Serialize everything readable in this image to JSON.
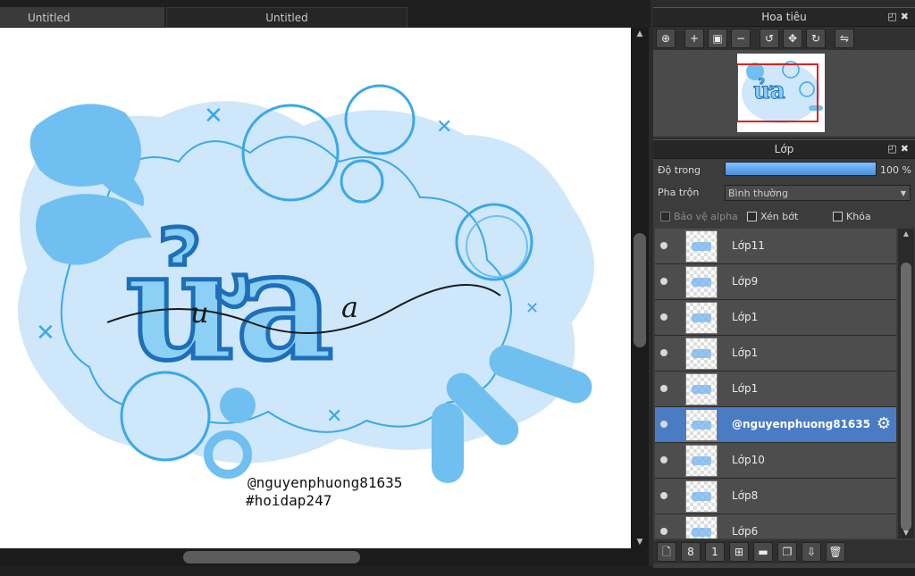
{
  "tabs": [
    {
      "label": "Untitled"
    },
    {
      "label": "Untitled"
    }
  ],
  "navigator": {
    "title": "Hoa tiêu",
    "tools": [
      {
        "icon": "zoom-fit-icon",
        "glyph": "⊕"
      },
      {
        "icon": "zoom-in-icon",
        "glyph": "+"
      },
      {
        "icon": "fit-screen-icon",
        "glyph": "▣"
      },
      {
        "icon": "zoom-out-icon",
        "glyph": "−"
      },
      {
        "icon": "rotate-left-icon",
        "glyph": "↺"
      },
      {
        "icon": "reset-icon",
        "glyph": "✥"
      },
      {
        "icon": "rotate-right-icon",
        "glyph": "↻"
      },
      {
        "icon": "flip-icon",
        "glyph": "⇋"
      }
    ]
  },
  "layers_panel": {
    "title": "Lớp",
    "opacity_label": "Độ trong",
    "opacity_value": "100 %",
    "opacity_fraction": 1.0,
    "blend_label": "Pha trộn",
    "blend_value": "Bình thường",
    "protect_alpha": "Bảo vệ alpha",
    "clip": "Xén bớt",
    "lock": "Khóa",
    "layers": [
      {
        "name": "Lớp11",
        "selected": false
      },
      {
        "name": "Lớp9",
        "selected": false
      },
      {
        "name": "Lớp1",
        "selected": false
      },
      {
        "name": "Lớp1",
        "selected": false
      },
      {
        "name": "Lớp1",
        "selected": false
      },
      {
        "name": "@nguyenphuong81635",
        "selected": true
      },
      {
        "name": "Lớp10",
        "selected": false
      },
      {
        "name": "Lớp8",
        "selected": false
      },
      {
        "name": "Lớp6",
        "selected": false
      }
    ],
    "bottom_tools": [
      {
        "icon": "new-layer-icon",
        "glyph": "🗋"
      },
      {
        "icon": "new-8bit-layer-icon",
        "glyph": "8"
      },
      {
        "icon": "new-1bit-layer-icon",
        "glyph": "1"
      },
      {
        "icon": "add-layer-menu-icon",
        "glyph": "⊞"
      },
      {
        "icon": "folder-icon",
        "glyph": "▬"
      },
      {
        "icon": "duplicate-layer-icon",
        "glyph": "❐"
      },
      {
        "icon": "merge-down-icon",
        "glyph": "⇩"
      },
      {
        "icon": "delete-layer-icon",
        "glyph": "🗑"
      }
    ]
  },
  "artwork": {
    "word": "ửa",
    "script_letters": [
      "u",
      "a"
    ],
    "credit_line1": "@nguyenphuong81635",
    "credit_line2": "#hoidap247",
    "colors": {
      "light": "#cfe7fb",
      "mid": "#6fc0f0",
      "dark": "#1c6fb8",
      "outline": "#3aa8e8"
    }
  }
}
